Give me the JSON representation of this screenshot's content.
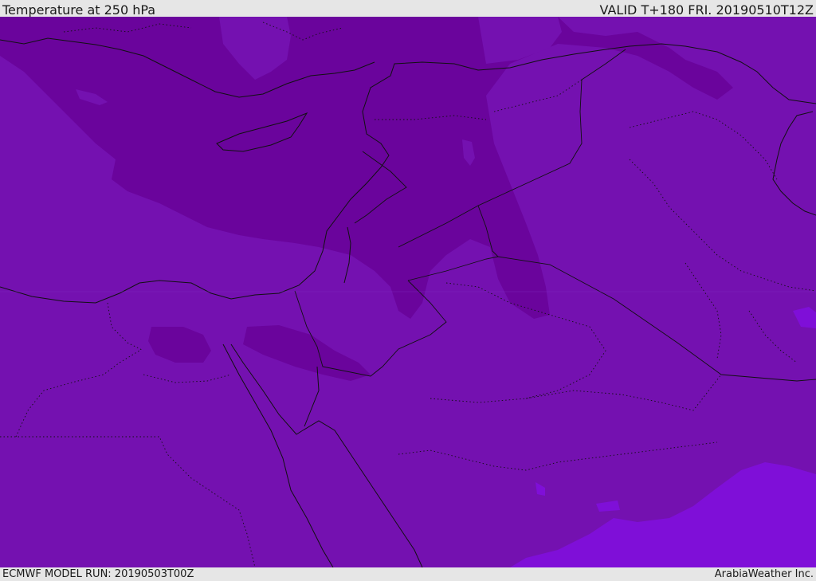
{
  "header": {
    "title": "Temperature at 250 hPa",
    "valid": "VALID T+180 FRI. 20190510T12Z"
  },
  "footer": {
    "model_run": "ECMWF MODEL RUN: 20190503T00Z",
    "credit": "ArabiaWeather Inc."
  },
  "map": {
    "field": "Temperature at 250 hPa",
    "colors": {
      "background": "#7411b0",
      "cold_band": "#6a049c",
      "warm_patch": "#7f0fd8",
      "line": "#111111",
      "frame": "#e6e6e6"
    }
  }
}
